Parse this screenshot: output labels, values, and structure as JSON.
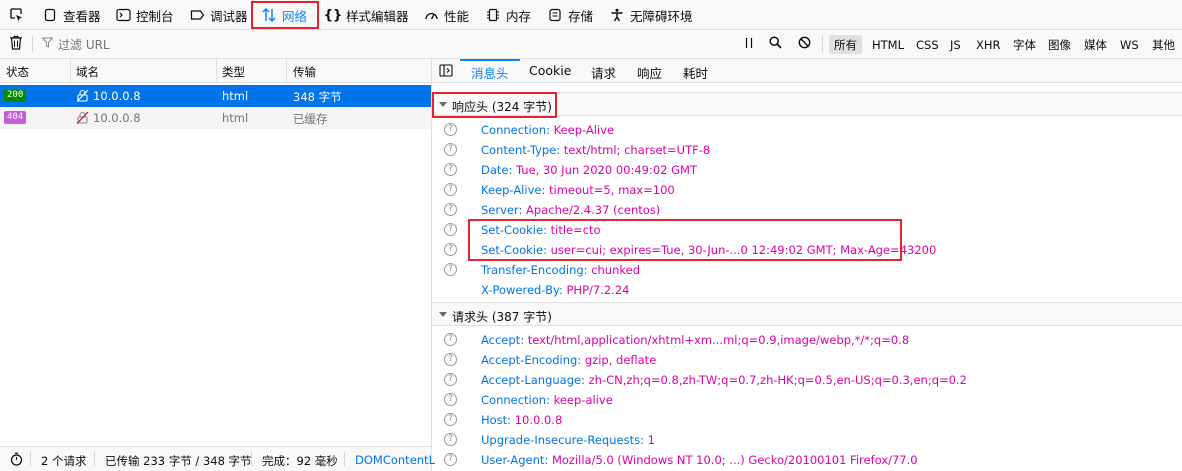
{
  "toolbar": {
    "items": [
      {
        "label": "查看器",
        "icon": "inspector-icon"
      },
      {
        "label": "控制台",
        "icon": "console-icon"
      },
      {
        "label": "调试器",
        "icon": "debugger-icon"
      },
      {
        "label": "网络",
        "icon": "network-icon",
        "active": true
      },
      {
        "label": "样式编辑器",
        "icon": "style-editor-icon"
      },
      {
        "label": "性能",
        "icon": "performance-icon"
      },
      {
        "label": "内存",
        "icon": "memory-icon"
      },
      {
        "label": "存储",
        "icon": "storage-icon"
      },
      {
        "label": "无障碍环境",
        "icon": "accessibility-icon"
      }
    ]
  },
  "filterbar": {
    "placeholder": "过滤 URL",
    "types": [
      "所有",
      "HTML",
      "CSS",
      "JS",
      "XHR",
      "字体",
      "图像",
      "媒体",
      "WS",
      "其他"
    ],
    "selected": "所有"
  },
  "request_list": {
    "columns": [
      "状态",
      "域名",
      "类型",
      "传输"
    ],
    "rows": [
      {
        "status": "200",
        "domain": "10.0.0.8",
        "type": "html",
        "transfer": "348 字节"
      },
      {
        "status": "404",
        "domain": "10.0.0.8",
        "type": "html",
        "transfer": "已缓存"
      }
    ]
  },
  "statusbar": {
    "requests": "2 个请求",
    "transferred": "已传输 233 字节 / 348 字节",
    "finish": "完成：92 毫秒",
    "dom": "DOMContentL"
  },
  "details": {
    "tabs": [
      "消息头",
      "Cookie",
      "请求",
      "响应",
      "耗时"
    ],
    "active_tab": "消息头",
    "response_section": {
      "title": "响应头 (324 字节)",
      "headers": [
        {
          "name": "Connection:",
          "value": "Keep-Alive"
        },
        {
          "name": "Content-Type:",
          "value": "text/html; charset=UTF-8"
        },
        {
          "name": "Date:",
          "value": "Tue, 30 Jun 2020 00:49:02 GMT"
        },
        {
          "name": "Keep-Alive:",
          "value": "timeout=5, max=100"
        },
        {
          "name": "Server:",
          "value": "Apache/2.4.37 (centos)"
        },
        {
          "name": "Set-Cookie:",
          "value": "title=cto"
        },
        {
          "name": "Set-Cookie:",
          "value": "user=cui; expires=Tue, 30-Jun-...0 12:49:02 GMT; Max-Age=43200"
        },
        {
          "name": "Transfer-Encoding:",
          "value": "chunked"
        },
        {
          "name": "X-Powered-By:",
          "value": "PHP/7.2.24"
        }
      ]
    },
    "request_section": {
      "title": "请求头 (387 字节)",
      "headers": [
        {
          "name": "Accept:",
          "value": "text/html,application/xhtml+xm...ml;q=0.9,image/webp,*/*;q=0.8"
        },
        {
          "name": "Accept-Encoding:",
          "value": "gzip, deflate"
        },
        {
          "name": "Accept-Language:",
          "value": "zh-CN,zh;q=0.8,zh-TW;q=0.7,zh-HK;q=0.5,en-US;q=0.3,en;q=0.2"
        },
        {
          "name": "Connection:",
          "value": "keep-alive"
        },
        {
          "name": "Host:",
          "value": "10.0.0.8"
        },
        {
          "name": "Upgrade-Insecure-Requests:",
          "value": "1"
        },
        {
          "name": "User-Agent:",
          "value": "Mozilla/5.0 (Windows NT 10.0; ...) Gecko/20100101 Firefox/77.0"
        }
      ]
    }
  },
  "colors": {
    "accent": "#0a84ff",
    "selected_row": "#0074e8",
    "highlight_box": "#e5232d",
    "header_name": "#0074e8",
    "header_value": "#dd00a9",
    "status_200": "#058b00",
    "status_404": "#c260d9"
  }
}
